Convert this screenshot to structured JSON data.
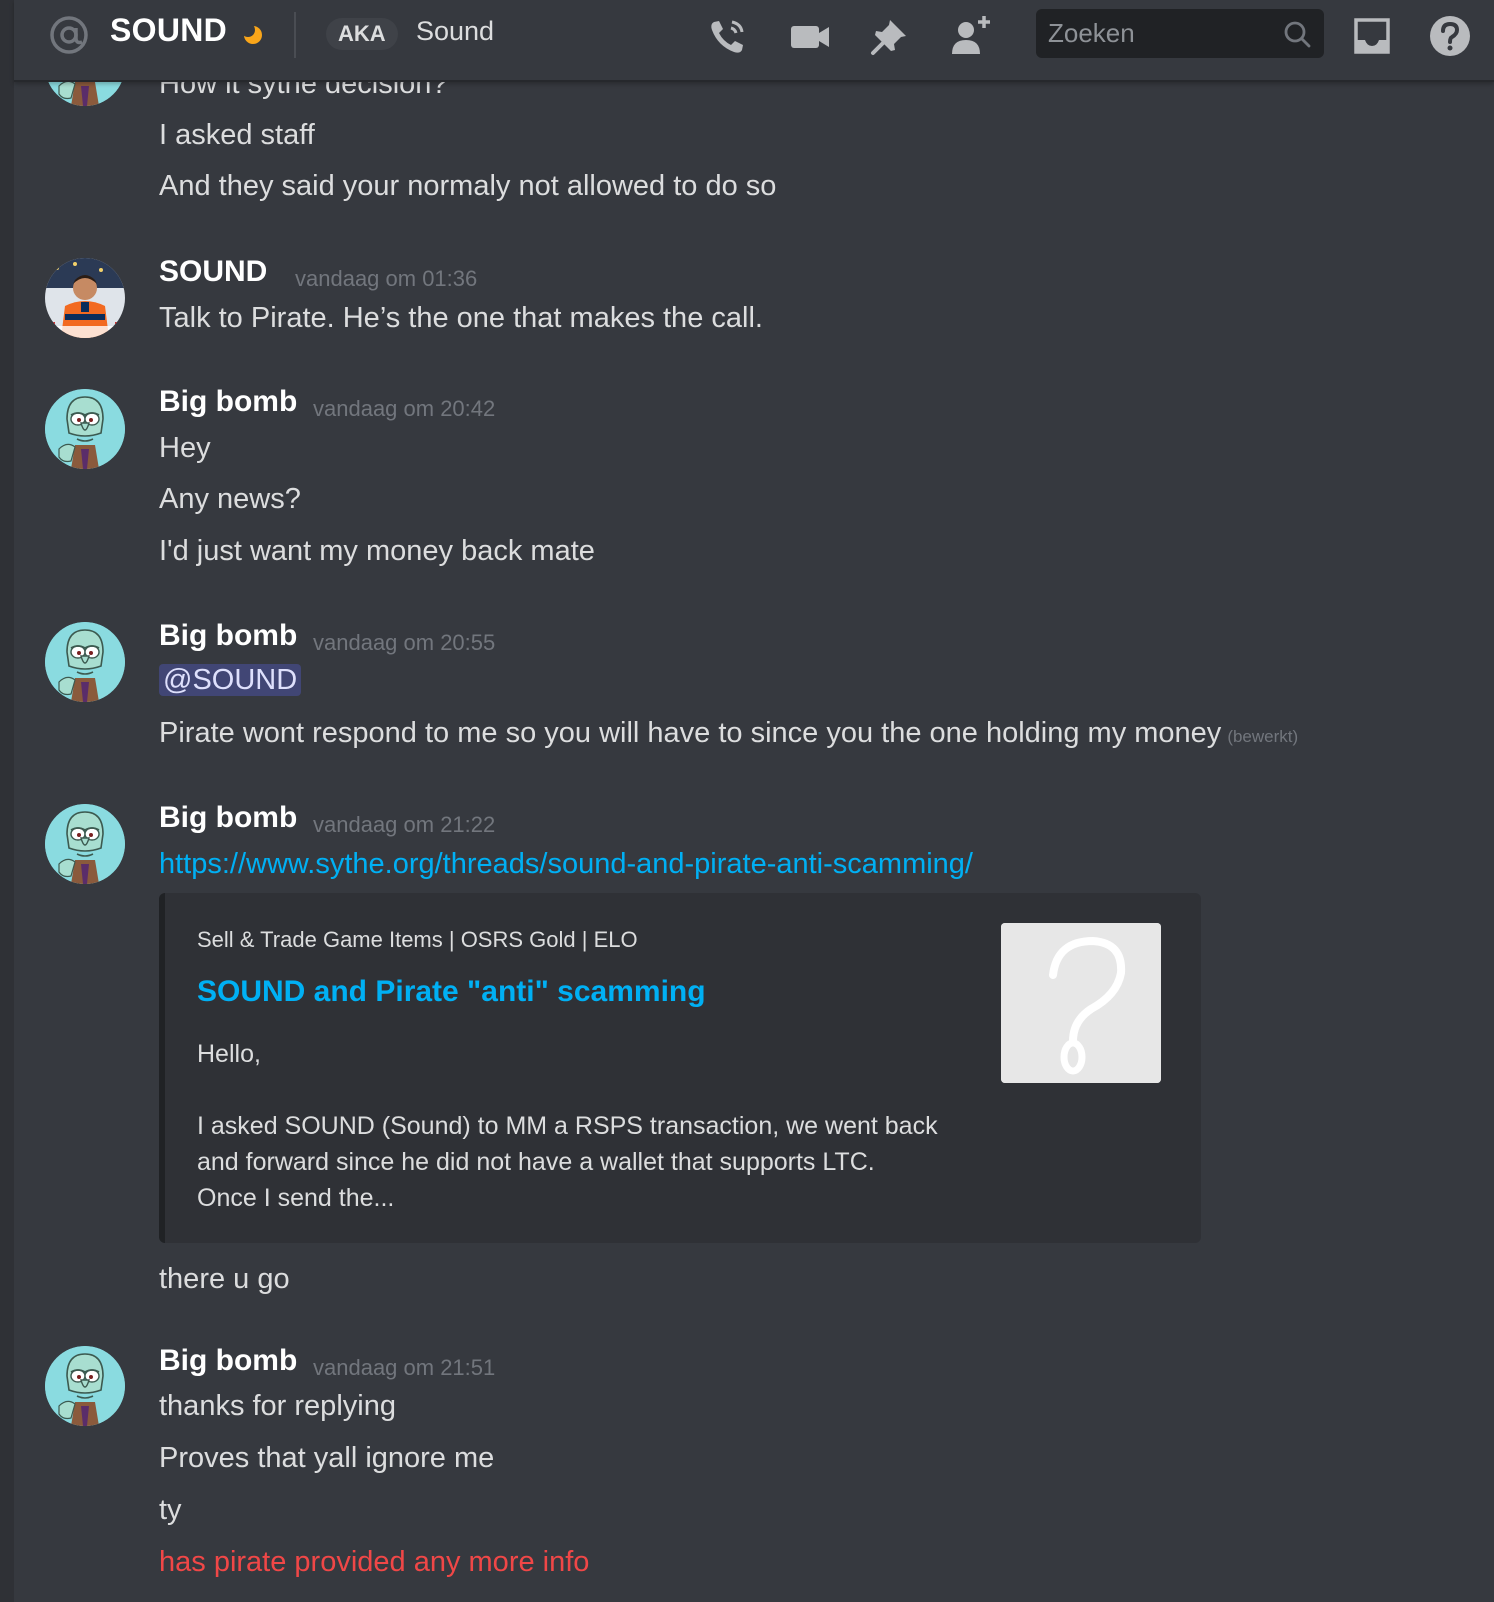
{
  "header": {
    "title": "SOUND",
    "aka_label": "AKA",
    "nickname": "Sound",
    "search_placeholder": "Zoeken",
    "icons": [
      "at-icon",
      "moon-status-icon",
      "phone-call-icon",
      "video-call-icon",
      "pin-icon",
      "add-friend-icon",
      "search-icon",
      "inbox-icon",
      "help-icon"
    ],
    "colors": {
      "background": "#36393f",
      "search_bg": "#202225",
      "status_moon": "#faa61a"
    }
  },
  "messages": {
    "top_lines": [
      "How it sythe decision?",
      "I asked staff",
      "And they said your normaly not allowed to do so"
    ],
    "groups": [
      {
        "author": "SOUND",
        "time": "vandaag om 01:36",
        "lines": [
          "Talk to Pirate. He’s the one that makes the call."
        ]
      },
      {
        "author": "Big bomb",
        "time": "vandaag om 20:42",
        "lines": [
          "Hey",
          "Any news?",
          "I'd just want my money back mate"
        ]
      },
      {
        "author": "Big bomb",
        "time": "vandaag om 20:55",
        "mention": "@SOUND",
        "lines": [
          "Pirate wont respond to me so you will have to since you the one holding my money"
        ],
        "edited": "(bewerkt)"
      },
      {
        "author": "Big bomb",
        "time": "vandaag om 21:22",
        "link": "https://www.sythe.org/threads/sound-and-pirate-anti-scamming/",
        "embed": {
          "provider": "Sell & Trade Game Items | OSRS Gold | ELO",
          "title": "SOUND and Pirate \"anti\" scamming",
          "description": [
            "Hello,",
            "",
            "I asked SOUND (Sound) to MM a RSPS transaction, we went back",
            "and forward since he did not have a wallet that supports LTC.",
            "Once I send the..."
          ],
          "thumbnail_icon": "question-mark-icon"
        },
        "lines": [
          "there u go"
        ]
      },
      {
        "author": "Big bomb",
        "time": "vandaag om 21:51",
        "lines": [
          "thanks for replying",
          "Proves that yall ignore me",
          "ty"
        ],
        "failed_line": "has pirate provided any more info"
      }
    ],
    "colors": {
      "text": "#dcddde",
      "username": "#ffffff",
      "timestamp": "#72767d",
      "link": "#00b0f4",
      "failed": "#f04747",
      "mention_bg": "#414675"
    }
  }
}
